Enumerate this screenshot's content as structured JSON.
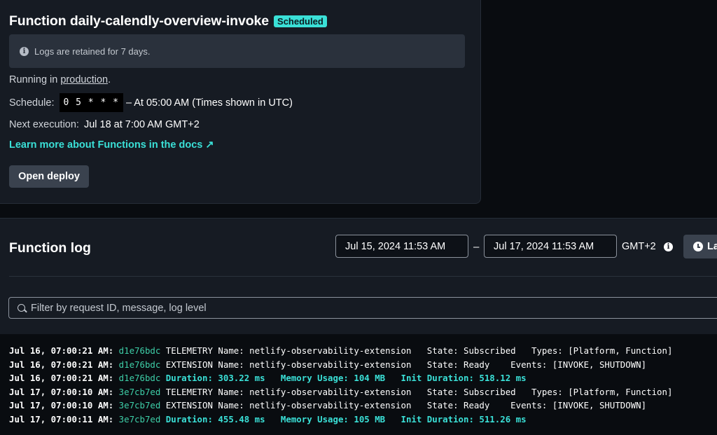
{
  "overview": {
    "title": "Function daily-calendly-overview-invoke",
    "badge": "Scheduled",
    "notice": "Logs are retained for 7 days.",
    "running_prefix": "Running in ",
    "running_link": "production",
    "running_suffix": ".",
    "schedule_label": "Schedule:",
    "cron": "0 5 * * *",
    "schedule_desc": "– At 05:00 AM (Times shown in UTC)",
    "next_label": "Next execution:",
    "next_value": "Jul 18 at 7:00 AM GMT+2",
    "docs_link": "Learn more about Functions in the docs ↗",
    "open_deploy": "Open deploy"
  },
  "log": {
    "title": "Function log",
    "from": "Jul 15, 2024 11:53 AM",
    "dash": "–",
    "to": "Jul 17, 2024 11:53 AM",
    "timezone": "GMT+2",
    "last_button": "La",
    "filter_placeholder": "Filter by request ID, message, log level"
  },
  "entries": [
    {
      "ts": "Jul 16, 07:00:21 AM:",
      "id": "d1e76bdc",
      "msg": " TELEMETRY Name: netlify-observability-extension   State: Subscribed   Types: [Platform, Function]",
      "metric": false
    },
    {
      "ts": "Jul 16, 07:00:21 AM:",
      "id": "d1e76bdc",
      "msg": " EXTENSION Name: netlify-observability-extension   State: Ready    Events: [INVOKE, SHUTDOWN]",
      "metric": false
    },
    {
      "ts": "Jul 16, 07:00:21 AM:",
      "id": "d1e76bdc",
      "msg": " Duration: 303.22 ms   Memory Usage: 104 MB   Init Duration: 518.12 ms",
      "metric": true
    },
    {
      "ts": "Jul 17, 07:00:10 AM:",
      "id": "3e7cb7ed",
      "msg": " TELEMETRY Name: netlify-observability-extension   State: Subscribed   Types: [Platform, Function]",
      "metric": false
    },
    {
      "ts": "Jul 17, 07:00:10 AM:",
      "id": "3e7cb7ed",
      "msg": " EXTENSION Name: netlify-observability-extension   State: Ready    Events: [INVOKE, SHUTDOWN]",
      "metric": false
    },
    {
      "ts": "Jul 17, 07:00:11 AM:",
      "id": "3e7cb7ed",
      "msg": " Duration: 455.48 ms   Memory Usage: 105 MB   Init Duration: 511.26 ms",
      "metric": true
    }
  ]
}
